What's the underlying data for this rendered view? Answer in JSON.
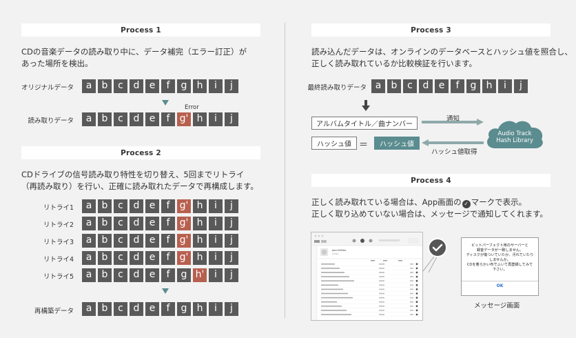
{
  "process1": {
    "title": "Process 1",
    "desc": [
      "CDの音楽データの読み取り中に、データ補完（エラー訂正）が",
      "あった場所を検出。"
    ],
    "row1_label": "オリジナルデータ",
    "row2_label": "読み取りデータ",
    "error_label": "Error",
    "row1": [
      "a",
      "b",
      "c",
      "d",
      "e",
      "f",
      "g",
      "h",
      "i",
      "j"
    ],
    "row2": [
      "a",
      "b",
      "c",
      "d",
      "e",
      "f",
      "g'",
      "h",
      "i",
      "j"
    ]
  },
  "process2": {
    "title": "Process 2",
    "desc": [
      "CDドライブの信号読み取り特性を切り替え、5回までリトライ",
      "（再読み取り）を行い、正確に読み取れたデータで再構成します。"
    ],
    "retries": [
      {
        "label": "リトライ1",
        "cells": [
          "a",
          "b",
          "c",
          "d",
          "e",
          "f",
          "g'",
          "h",
          "i",
          "j"
        ],
        "err": 6
      },
      {
        "label": "リトライ2",
        "cells": [
          "a",
          "b",
          "c",
          "d",
          "e",
          "f",
          "g'",
          "h",
          "i",
          "j"
        ],
        "err": 6
      },
      {
        "label": "リトライ3",
        "cells": [
          "a",
          "b",
          "c",
          "d",
          "e",
          "f",
          "g'",
          "h",
          "i",
          "j"
        ],
        "err": 6
      },
      {
        "label": "リトライ4",
        "cells": [
          "a",
          "b",
          "c",
          "d",
          "e",
          "f",
          "g'",
          "h",
          "i",
          "j"
        ],
        "err": 6
      },
      {
        "label": "リトライ5",
        "cells": [
          "a",
          "b",
          "c",
          "d",
          "e",
          "f",
          "g",
          "h'",
          "i",
          "j"
        ],
        "err": 7
      }
    ],
    "rebuilt_label": "再構築データ",
    "rebuilt": [
      "a",
      "b",
      "c",
      "d",
      "e",
      "f",
      "g",
      "h",
      "i",
      "j"
    ]
  },
  "process3": {
    "title": "Process 3",
    "desc": [
      "読み込んだデータは、オンラインのデータベースとハッシュ値を照合し、",
      "正しく読み取れているか比較検証を行います。"
    ],
    "row_label": "最終読み取りデータ",
    "row": [
      "a",
      "b",
      "c",
      "d",
      "e",
      "f",
      "g",
      "h",
      "i",
      "j"
    ],
    "album_box": "アルバムタイトル／曲ナンバー",
    "notify": "通知",
    "hash_box": "ハッシュ値",
    "equals": "＝",
    "hash_teal": "ハッシュ値",
    "hash_get": "ハッシュ値取得",
    "cloud_line1": "Audio Track",
    "cloud_line2": "Hash Library"
  },
  "process4": {
    "title": "Process 4",
    "desc_pre": "正しく読み取れている場合は、App画面の",
    "desc_post": "マークで表示。",
    "desc2": "正しく取り込めていない場合は、メッセージで通知してくれます。",
    "dialog_text": [
      "ビットパーフェクト用のサーバーと",
      "録音データが一致しません。",
      "ディスクが傷ついていたか、汚れていたり",
      "しませんか。",
      "CDを着らかい布でふいて再登録してみて",
      "下さい。"
    ],
    "dialog_ok": "OK",
    "caption": "メッセージ画面",
    "app_album": "Jack Killfree",
    "app_sub": "LIVING"
  },
  "colors": {
    "teal": "#5b8c8f",
    "cell": "#595959",
    "error": "#b86050"
  }
}
